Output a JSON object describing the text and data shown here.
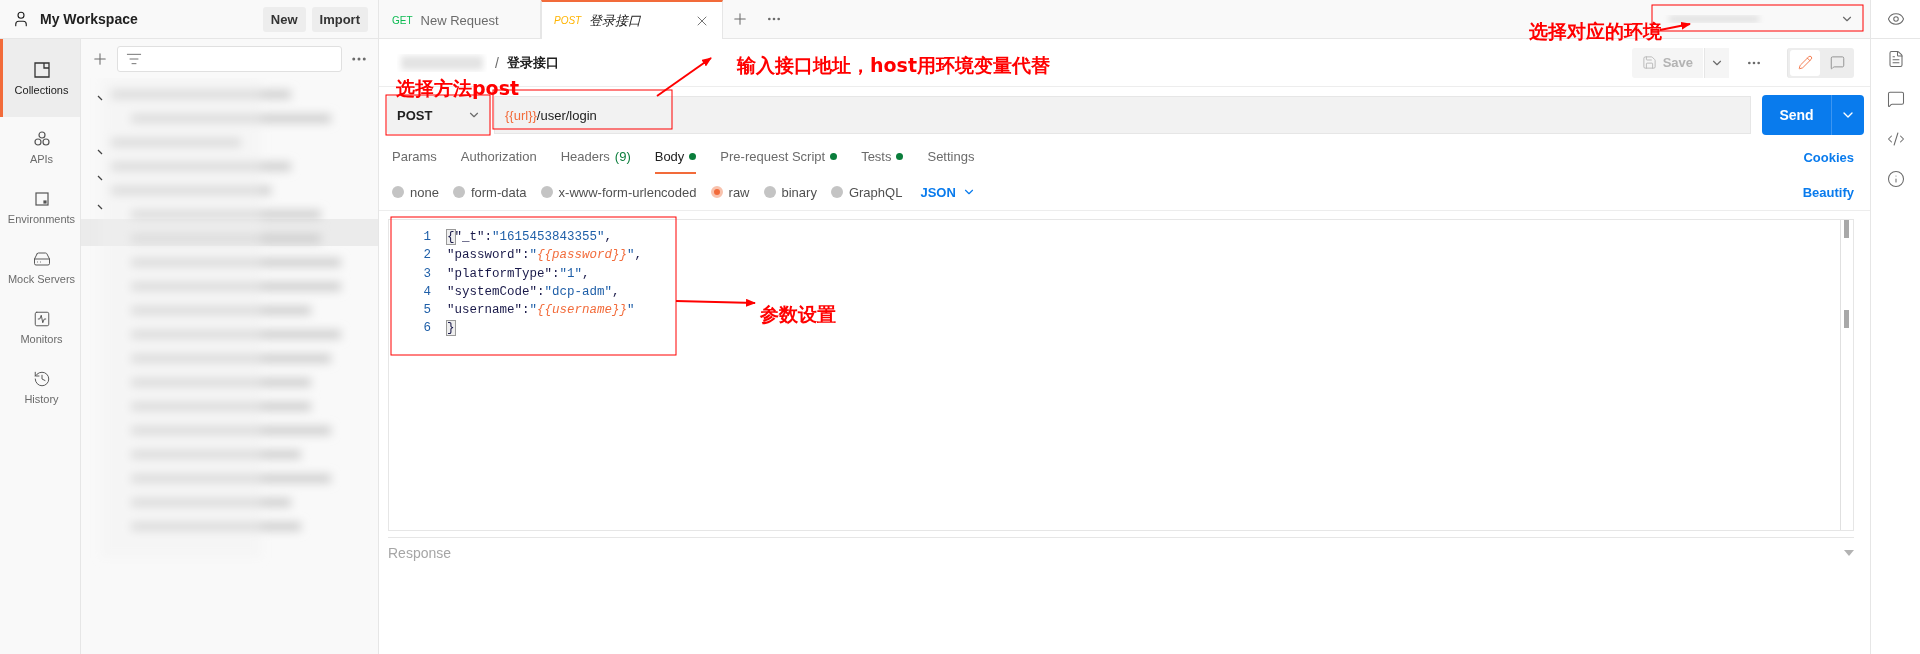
{
  "workspace": {
    "title": "My Workspace",
    "buttons": [
      "New",
      "Import"
    ]
  },
  "nav": [
    {
      "label": "Collections",
      "selected": true
    },
    {
      "label": "APIs",
      "selected": false
    },
    {
      "label": "Environments",
      "selected": false
    },
    {
      "label": "Mock Servers",
      "selected": false
    },
    {
      "label": "Monitors",
      "selected": false
    },
    {
      "label": "History",
      "selected": false
    }
  ],
  "tabs": [
    {
      "method": "GET",
      "title": "New Request",
      "selected": false,
      "preview": false
    },
    {
      "method": "POST",
      "title": "登录接口",
      "selected": true,
      "preview": true
    }
  ],
  "breadcrumb": {
    "separator": "/",
    "name": "登录接口"
  },
  "header_actions": {
    "save": "Save"
  },
  "request": {
    "method": "POST",
    "url_variable": "{{url}}",
    "url_path": "/user/login",
    "send": "Send"
  },
  "request_tabs": [
    {
      "label": "Params",
      "dot": false,
      "selected": false
    },
    {
      "label": "Authorization",
      "dot": false,
      "selected": false
    },
    {
      "label": "Headers",
      "count": "(9)",
      "dot": false,
      "selected": false
    },
    {
      "label": "Body",
      "dot": true,
      "selected": true
    },
    {
      "label": "Pre-request Script",
      "dot": true,
      "selected": false
    },
    {
      "label": "Tests",
      "dot": true,
      "selected": false
    },
    {
      "label": "Settings",
      "dot": false,
      "selected": false
    }
  ],
  "cookies": "Cookies",
  "body_types": [
    {
      "label": "none",
      "selected": false
    },
    {
      "label": "form-data",
      "selected": false
    },
    {
      "label": "x-www-form-urlencoded",
      "selected": false
    },
    {
      "label": "raw",
      "selected": true
    },
    {
      "label": "binary",
      "selected": false
    },
    {
      "label": "GraphQL",
      "selected": false
    }
  ],
  "body_language": "JSON",
  "beautify": "Beautify",
  "editor": {
    "lines": [
      {
        "number": "1",
        "tokens": [
          {
            "kind": "bracket",
            "text": "{"
          },
          {
            "kind": "key",
            "text": "\"_t\""
          },
          {
            "kind": "punct",
            "text": ":"
          },
          {
            "kind": "string",
            "text": "\"1615453843355\""
          },
          {
            "kind": "punct",
            "text": ","
          }
        ]
      },
      {
        "number": "2",
        "tokens": [
          {
            "kind": "key",
            "text": "\"password\""
          },
          {
            "kind": "punct",
            "text": ":"
          },
          {
            "kind": "string",
            "text": "\""
          },
          {
            "kind": "variable",
            "text": "{{password}}"
          },
          {
            "kind": "string",
            "text": "\""
          },
          {
            "kind": "punct",
            "text": ","
          }
        ]
      },
      {
        "number": "3",
        "tokens": [
          {
            "kind": "key",
            "text": "\"platformType\""
          },
          {
            "kind": "punct",
            "text": ":"
          },
          {
            "kind": "string",
            "text": "\"1\""
          },
          {
            "kind": "punct",
            "text": ","
          }
        ]
      },
      {
        "number": "4",
        "tokens": [
          {
            "kind": "key",
            "text": "\"systemCode\""
          },
          {
            "kind": "punct",
            "text": ":"
          },
          {
            "kind": "string",
            "text": "\"dcp-adm\""
          },
          {
            "kind": "punct",
            "text": ","
          }
        ]
      },
      {
        "number": "5",
        "tokens": [
          {
            "kind": "key",
            "text": "\"username\""
          },
          {
            "kind": "punct",
            "text": ":"
          },
          {
            "kind": "string",
            "text": "\""
          },
          {
            "kind": "variable",
            "text": "{{username}}"
          },
          {
            "kind": "string",
            "text": "\""
          }
        ]
      },
      {
        "number": "6",
        "tokens": [
          {
            "kind": "bracket",
            "text": "}"
          }
        ]
      }
    ]
  },
  "response": {
    "label": "Response"
  },
  "annotations": [
    "选择方法post",
    "输入接口地址，host用环境变量代替",
    "选择对应的环境",
    "参数设置"
  ]
}
